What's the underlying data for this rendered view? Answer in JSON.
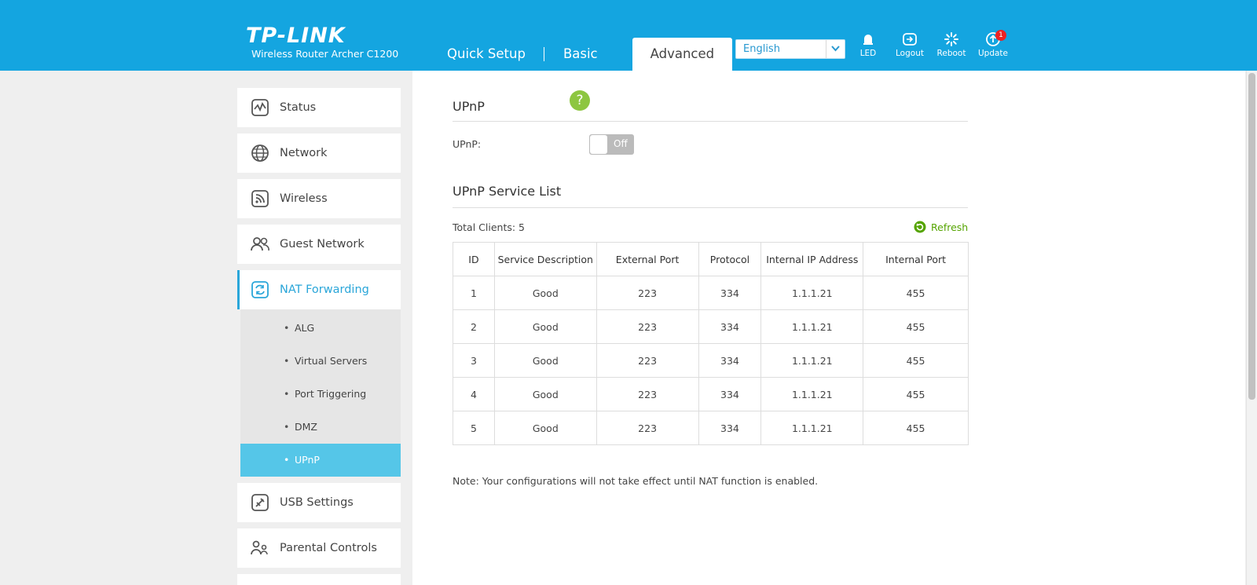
{
  "header": {
    "logo": "TP-LINK",
    "model": "Wireless Router Archer C1200",
    "tabs": [
      {
        "label": "Quick Setup"
      },
      {
        "label": "Basic"
      },
      {
        "label": "Advanced"
      }
    ],
    "language": "English",
    "icons": [
      {
        "name": "led-icon",
        "label": "LED"
      },
      {
        "name": "logout-icon",
        "label": "Logout"
      },
      {
        "name": "reboot-icon",
        "label": "Reboot"
      },
      {
        "name": "update-icon",
        "label": "Update",
        "badge": "1"
      }
    ]
  },
  "sidebar": {
    "items": [
      {
        "label": "Status",
        "icon": "status-icon"
      },
      {
        "label": "Network",
        "icon": "globe-icon"
      },
      {
        "label": "Wireless",
        "icon": "wireless-icon"
      },
      {
        "label": "Guest Network",
        "icon": "guest-icon"
      },
      {
        "label": "NAT Forwarding",
        "icon": "nat-icon"
      },
      {
        "label": "USB Settings",
        "icon": "usb-icon"
      },
      {
        "label": "Parental Controls",
        "icon": "parental-icon"
      }
    ],
    "submenu": [
      {
        "label": "ALG"
      },
      {
        "label": "Virtual Servers"
      },
      {
        "label": "Port Triggering"
      },
      {
        "label": "DMZ"
      },
      {
        "label": "UPnP"
      }
    ]
  },
  "main": {
    "upnp_title": "UPnP",
    "upnp_label": "UPnP:",
    "toggle_state": "Off",
    "service_title": "UPnP Service List",
    "total_clients": "Total Clients:  5",
    "refresh_label": "Refresh",
    "columns": [
      "ID",
      "Service Description",
      "External Port",
      "Protocol",
      "Internal IP Address",
      "Internal Port"
    ],
    "rows": [
      [
        "1",
        "Good",
        "223",
        "334",
        "1.1.1.21",
        "455"
      ],
      [
        "2",
        "Good",
        "223",
        "334",
        "1.1.1.21",
        "455"
      ],
      [
        "3",
        "Good",
        "223",
        "334",
        "1.1.1.21",
        "455"
      ],
      [
        "4",
        "Good",
        "223",
        "334",
        "1.1.1.21",
        "455"
      ],
      [
        "5",
        "Good",
        "223",
        "334",
        "1.1.1.21",
        "455"
      ]
    ],
    "note": "Note: Your configurations will not take effect until NAT function is enabled.",
    "help": "?"
  },
  "colors": {
    "header_bg": "#14a5e0",
    "accent": "#2aa6d9",
    "submenu_active": "#55c6e8",
    "refresh_green": "#55a400",
    "help_green": "#8dc641"
  }
}
